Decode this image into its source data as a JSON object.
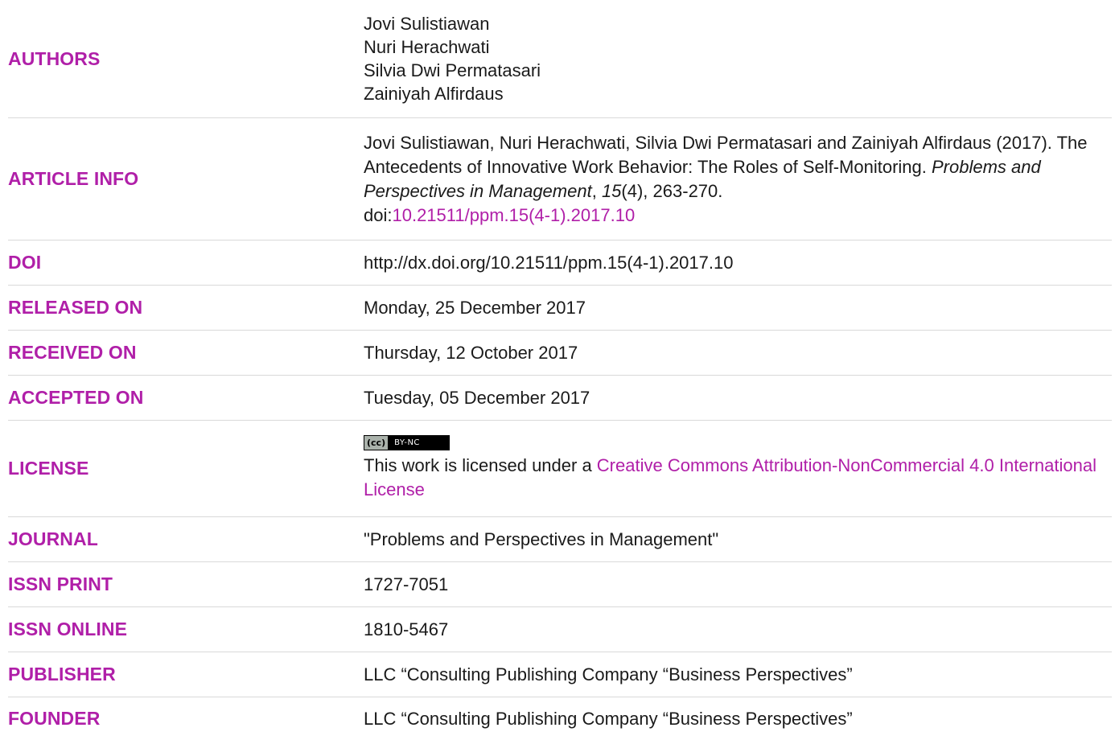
{
  "rows": {
    "authors": {
      "label": "AUTHORS",
      "names": [
        "Jovi Sulistiawan",
        "Nuri Herachwati",
        "Silvia Dwi Permatasari",
        "Zainiyah Alfirdaus"
      ]
    },
    "article_info": {
      "label": "ARTICLE INFO",
      "citation_authors": "Jovi Sulistiawan, Nuri Herachwati, Silvia Dwi Permatasari and Zainiyah Alfirdaus (2017). The Antecedents of Innovative Work Behavior: The Roles of Self-Monitoring. ",
      "journal": "Problems and Perspectives in Management",
      "comma": ", ",
      "volume": "15",
      "issue_pages": "(4), 263-270.",
      "doi_prefix": "doi:",
      "doi_link": "10.21511/ppm.15(4-1).2017.10"
    },
    "doi": {
      "label": "DOI",
      "value": "http://dx.doi.org/10.21511/ppm.15(4-1).2017.10"
    },
    "released": {
      "label": "RELEASED ON",
      "value": "Monday, 25 December 2017"
    },
    "received": {
      "label": "RECEIVED ON",
      "value": "Thursday, 12 October 2017"
    },
    "accepted": {
      "label": "ACCEPTED ON",
      "value": "Tuesday, 05 December 2017"
    },
    "license": {
      "label": "LICENSE",
      "badge_cc": "(cc)",
      "badge_terms": "BY-NC",
      "text_prefix": "This work is licensed under a ",
      "link_text": "Creative Commons Attribution-NonCommercial 4.0 International License"
    },
    "journal": {
      "label": "JOURNAL",
      "value": "\"Problems and Perspectives in Management\""
    },
    "issn_print": {
      "label": "ISSN PRINT",
      "value": "1727-7051"
    },
    "issn_online": {
      "label": "ISSN ONLINE",
      "value": "1810-5467"
    },
    "publisher": {
      "label": "PUBLISHER",
      "value": "LLC “Consulting Publishing Company “Business Perspectives”"
    },
    "founder": {
      "label": "FOUNDER",
      "value": "LLC “Consulting Publishing Company “Business Perspectives”"
    }
  },
  "colors": {
    "accent": "#b01fa8",
    "text": "#1a1a1a",
    "divider": "#d9d9d9"
  }
}
